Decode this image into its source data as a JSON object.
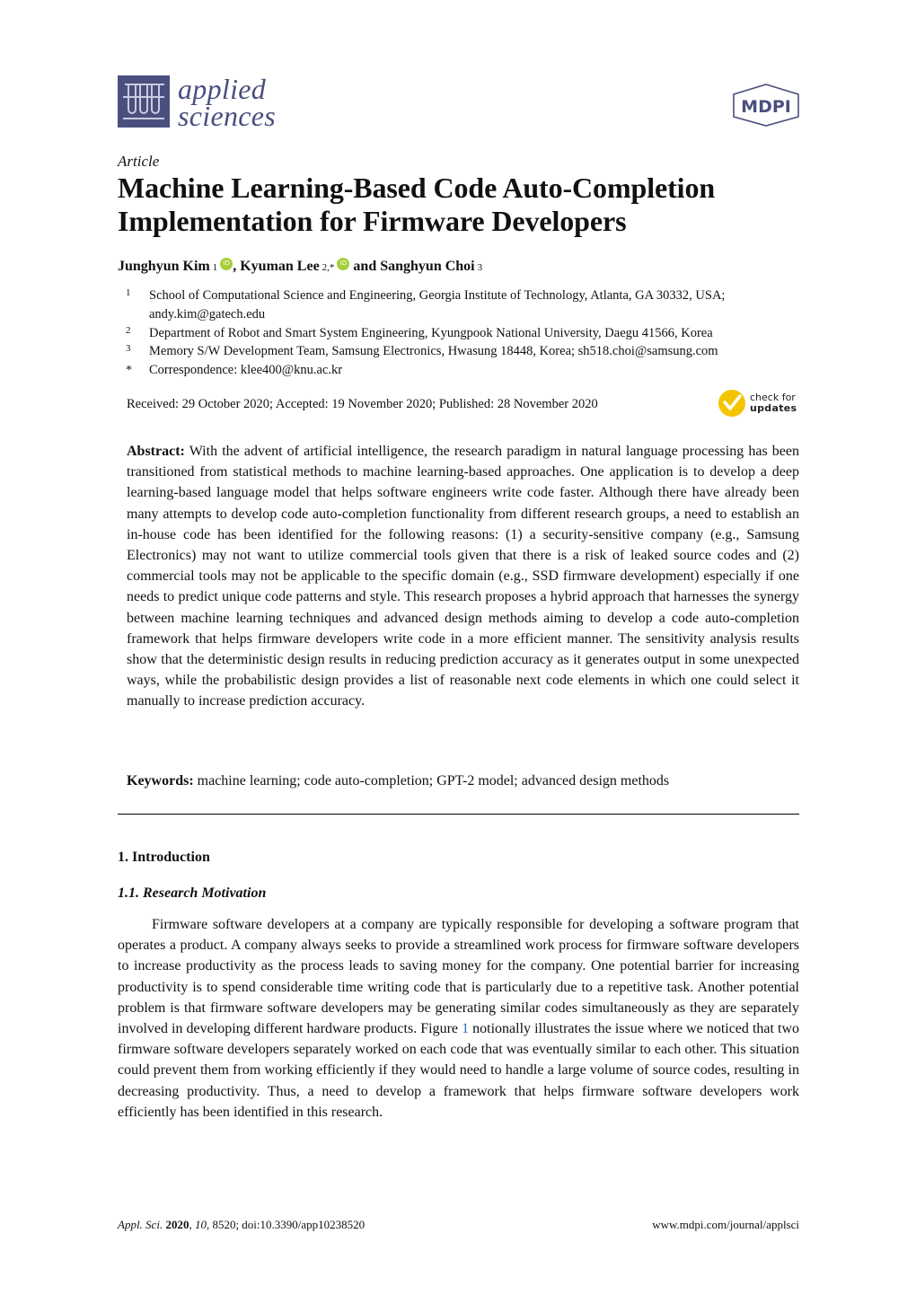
{
  "header": {
    "journal_name_line1": "applied",
    "journal_name_line2": "sciences",
    "journal_logo_icon": "test-tubes-icon",
    "publisher_logo_text": "MDPI",
    "brand_color": "#4a4f7e"
  },
  "article": {
    "type": "Article",
    "title": "Machine Learning-Based Code Auto-Completion Implementation for Firmware Developers",
    "authors": [
      {
        "name": "Junghyun Kim",
        "sup": "1",
        "orcid": true,
        "separator": ", "
      },
      {
        "name": "Kyuman Lee",
        "sup": "2,*",
        "orcid": true,
        "separator": " and "
      },
      {
        "name": "Sanghyun Choi",
        "sup": "3",
        "orcid": false,
        "separator": ""
      }
    ],
    "affiliations": [
      {
        "mark": "1",
        "text": "School of Computational Science and Engineering, Georgia Institute of Technology, Atlanta, GA 30332, USA; andy.kim@gatech.edu"
      },
      {
        "mark": "2",
        "text": "Department of Robot and Smart System Engineering, Kyungpook National University, Daegu 41566, Korea"
      },
      {
        "mark": "3",
        "text": "Memory S/W Development Team, Samsung Electronics, Hwasung 18448, Korea; sh518.choi@samsung.com"
      },
      {
        "mark": "*",
        "text": "Correspondence: klee400@knu.ac.kr"
      }
    ],
    "dates": "Received: 29 October 2020; Accepted: 19 November 2020; Published: 28 November 2020",
    "check_updates": {
      "line1": "check for",
      "line2": "updates",
      "accent": "#f5c400"
    },
    "abstract_label": "Abstract:",
    "abstract_text": "With the advent of artificial intelligence, the research paradigm in natural language processing has been transitioned from statistical methods to machine learning-based approaches. One application is to develop a deep learning-based language model that helps software engineers write code faster. Although there have already been many attempts to develop code auto-completion functionality from different research groups, a need to establish an in-house code has been identified for the following reasons: (1) a security-sensitive company (e.g., Samsung Electronics) may not want to utilize commercial tools given that there is a risk of leaked source codes and (2) commercial tools may not be applicable to the specific domain (e.g., SSD firmware development) especially if one needs to predict unique code patterns and style.  This research proposes a hybrid approach that harnesses the synergy between machine learning techniques and advanced design methods aiming to develop a code auto-completion framework that helps firmware developers write code in a more efficient manner. The sensitivity analysis results show that the deterministic design results in reducing prediction accuracy as it generates output in some unexpected ways, while the probabilistic design provides a list of reasonable next code elements in which one could select it manually to increase prediction accuracy.",
    "keywords_label": "Keywords:",
    "keywords_text": "machine learning; code auto-completion; GPT-2 model; advanced design methods"
  },
  "sections": {
    "section1_heading": "1. Introduction",
    "subsection1_1_heading": "1.1. Research Motivation",
    "paragraph1_part1": "Firmware software developers at a company are typically responsible for developing a software program that operates a product.  A company always seeks to provide a streamlined work process for firmware software developers to increase productivity as the process leads to saving money for the company.  One potential barrier for increasing productivity is to spend considerable time writing code that is particularly due to a repetitive task. Another potential problem is that firmware software developers may be generating similar codes simultaneously as they are separately involved in developing different hardware products. Figure ",
    "figure_ref": "1",
    "paragraph1_part2": " notionally illustrates the issue where we noticed that two firmware software developers separately worked on each code that was eventually similar to each other. This situation could prevent them from working efficiently if they would need to handle a large volume of source codes, resulting in decreasing productivity. Thus, a need to develop a framework that helps firmware software developers work efficiently has been identified in this research.",
    "link_color": "#2a6fb5"
  },
  "footer": {
    "journal_abbrev": "Appl. Sci.",
    "year": "2020",
    "volume": "10",
    "rest": ", 8520; doi:10.3390/app10238520",
    "url": "www.mdpi.com/journal/applsci"
  }
}
